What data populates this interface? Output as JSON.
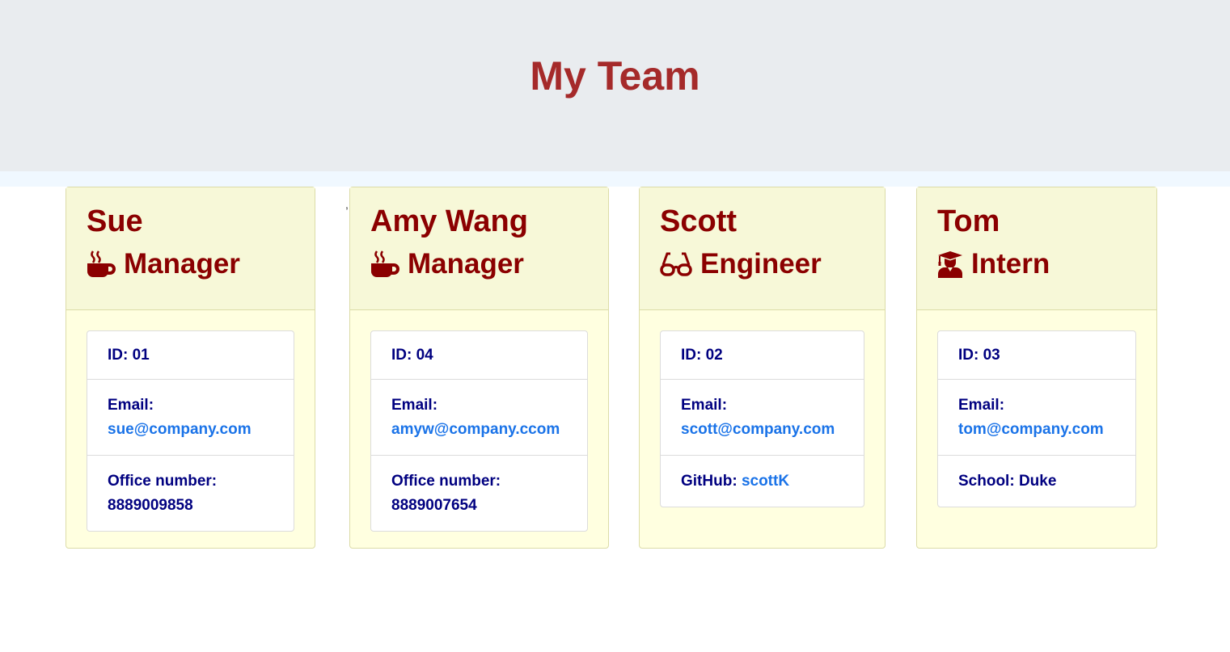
{
  "header": {
    "title": "My Team"
  },
  "stray_mark": ",",
  "cards": [
    {
      "name": "Sue",
      "role": "Manager",
      "icon": "coffee-icon",
      "id_label": "ID: 01",
      "email_label": "Email:",
      "email": "sue@company.com",
      "extra_label": "Office number:",
      "extra_value": "8889009858"
    },
    {
      "name": "Amy Wang",
      "role": "Manager",
      "icon": "coffee-icon",
      "id_label": "ID: 04",
      "email_label": "Email:",
      "email": "amyw@company.ccom",
      "extra_label": "Office number:",
      "extra_value": "8889007654"
    },
    {
      "name": "Scott",
      "role": "Engineer",
      "icon": "glasses-icon",
      "id_label": "ID: 02",
      "email_label": "Email:",
      "email": "scott@company.com",
      "extra_label": "GitHub:",
      "extra_value": "scottK"
    },
    {
      "name": "Tom",
      "role": "Intern",
      "icon": "graduate-icon",
      "id_label": "ID: 03",
      "email_label": "Email:",
      "email": "tom@company.com",
      "extra_label": "School: Duke",
      "extra_value": ""
    }
  ],
  "colors": {
    "title": "#a52a2a",
    "card_text": "#8b0000",
    "detail_text": "#000080",
    "link": "#1a73e8",
    "card_bg": "#ffffe0",
    "header_bg": "#e9ecef"
  }
}
